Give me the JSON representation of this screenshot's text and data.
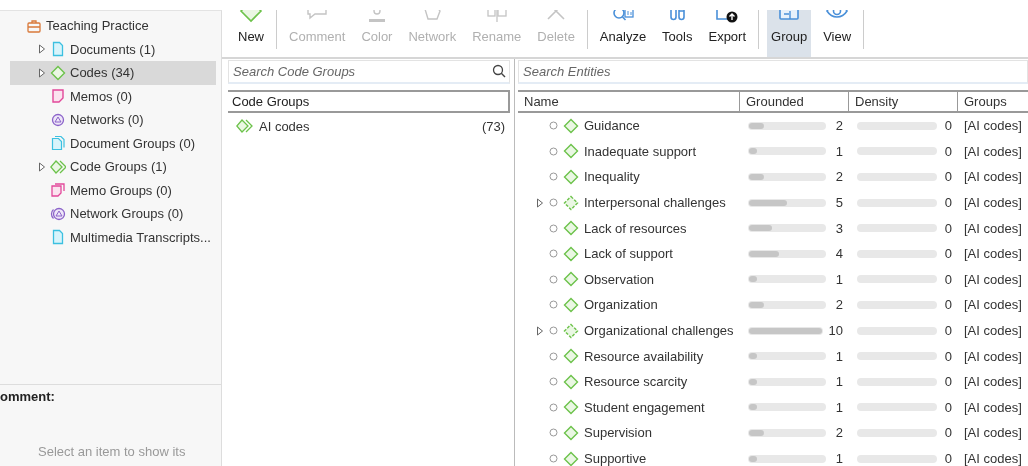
{
  "toolbar": {
    "groups": [
      {
        "buttons": [
          {
            "label": "New",
            "kind": "new",
            "disabled": false,
            "selected": false
          }
        ]
      },
      {
        "buttons": [
          {
            "label": "Comment",
            "kind": "comment",
            "disabled": true,
            "selected": false
          },
          {
            "label": "Color",
            "kind": "color",
            "disabled": true,
            "selected": false
          },
          {
            "label": "Network",
            "kind": "network",
            "disabled": true,
            "selected": false
          },
          {
            "label": "Rename",
            "kind": "rename",
            "disabled": true,
            "selected": false
          },
          {
            "label": "Delete",
            "kind": "delete",
            "disabled": true,
            "selected": false
          }
        ]
      },
      {
        "buttons": [
          {
            "label": "Analyze",
            "kind": "analyze",
            "disabled": false,
            "selected": false
          },
          {
            "label": "Tools",
            "kind": "tools",
            "disabled": false,
            "selected": false
          },
          {
            "label": "Export",
            "kind": "export",
            "disabled": false,
            "selected": false
          }
        ]
      },
      {
        "buttons": [
          {
            "label": "Group",
            "kind": "group",
            "disabled": false,
            "selected": true
          },
          {
            "label": "View",
            "kind": "view",
            "disabled": false,
            "selected": false
          }
        ]
      }
    ]
  },
  "sidebar": {
    "project": {
      "label": "Teaching Practice",
      "kind": "project",
      "children": [
        {
          "label": "Documents (1)",
          "kind": "document",
          "expander": true,
          "selected": false
        },
        {
          "label": "Codes (34)",
          "kind": "code",
          "expander": true,
          "selected": true
        },
        {
          "label": "Memos (0)",
          "kind": "memo",
          "expander": false,
          "selected": false
        },
        {
          "label": "Networks (0)",
          "kind": "network",
          "expander": false,
          "selected": false
        },
        {
          "label": "Document Groups (0)",
          "kind": "document-group",
          "expander": false,
          "selected": false
        },
        {
          "label": "Code Groups (1)",
          "kind": "code-group",
          "expander": true,
          "selected": false
        },
        {
          "label": "Memo Groups (0)",
          "kind": "memo-group",
          "expander": false,
          "selected": false
        },
        {
          "label": "Network Groups (0)",
          "kind": "network-group",
          "expander": false,
          "selected": false
        },
        {
          "label": "Multimedia Transcripts...",
          "kind": "transcript",
          "expander": false,
          "selected": false
        }
      ]
    }
  },
  "comment": {
    "label": "omment:",
    "hint": "Select an item to show its"
  },
  "code_groups": {
    "search": {
      "placeholder": "Search Code Groups"
    },
    "column": "Code Groups",
    "rows": [
      {
        "name": "AI codes",
        "count": "(73)",
        "selected": false
      }
    ]
  },
  "entities": {
    "search": {
      "placeholder": "Search Entities"
    },
    "columns": [
      "Name",
      "Grounded",
      "Density",
      "Groups"
    ],
    "rows": [
      {
        "name": "Guidance",
        "kind": "code",
        "grounded": {
          "value": "2",
          "level": 0.2
        },
        "density": {
          "value": "0",
          "level": 0
        },
        "groups": "[AI codes]"
      },
      {
        "name": "Inadequate support",
        "kind": "code",
        "grounded": {
          "value": "1",
          "level": 0.1
        },
        "density": {
          "value": "0",
          "level": 0
        },
        "groups": "[AI codes]"
      },
      {
        "name": "Inequality",
        "kind": "code",
        "grounded": {
          "value": "2",
          "level": 0.2
        },
        "density": {
          "value": "0",
          "level": 0
        },
        "groups": "[AI codes]"
      },
      {
        "name": "Interpersonal challenges",
        "kind": "parent",
        "grounded": {
          "value": "5",
          "level": 0.5
        },
        "density": {
          "value": "0",
          "level": 0
        },
        "groups": "[AI codes]"
      },
      {
        "name": "Lack of resources",
        "kind": "code",
        "grounded": {
          "value": "3",
          "level": 0.3
        },
        "density": {
          "value": "0",
          "level": 0
        },
        "groups": "[AI codes]"
      },
      {
        "name": "Lack of support",
        "kind": "code",
        "grounded": {
          "value": "4",
          "level": 0.4
        },
        "density": {
          "value": "0",
          "level": 0
        },
        "groups": "[AI codes]"
      },
      {
        "name": "Observation",
        "kind": "code",
        "grounded": {
          "value": "1",
          "level": 0.1
        },
        "density": {
          "value": "0",
          "level": 0
        },
        "groups": "[AI codes]"
      },
      {
        "name": "Organization",
        "kind": "code",
        "grounded": {
          "value": "2",
          "level": 0.2
        },
        "density": {
          "value": "0",
          "level": 0
        },
        "groups": "[AI codes]"
      },
      {
        "name": "Organizational challenges",
        "kind": "parent",
        "grounded": {
          "value": "10",
          "level": 1
        },
        "density": {
          "value": "0",
          "level": 0
        },
        "groups": "[AI codes]"
      },
      {
        "name": "Resource availability",
        "kind": "code",
        "grounded": {
          "value": "1",
          "level": 0.1
        },
        "density": {
          "value": "0",
          "level": 0
        },
        "groups": "[AI codes]"
      },
      {
        "name": "Resource scarcity",
        "kind": "code",
        "grounded": {
          "value": "1",
          "level": 0.1
        },
        "density": {
          "value": "0",
          "level": 0
        },
        "groups": "[AI codes]"
      },
      {
        "name": "Student engagement",
        "kind": "code",
        "grounded": {
          "value": "1",
          "level": 0.1
        },
        "density": {
          "value": "0",
          "level": 0
        },
        "groups": "[AI codes]"
      },
      {
        "name": "Supervision",
        "kind": "code",
        "grounded": {
          "value": "2",
          "level": 0.2
        },
        "density": {
          "value": "0",
          "level": 0
        },
        "groups": "[AI codes]"
      },
      {
        "name": "Supportive",
        "kind": "code",
        "grounded": {
          "value": "1",
          "level": 0.1
        },
        "density": {
          "value": "0",
          "level": 0
        },
        "groups": "[AI codes]"
      }
    ]
  }
}
